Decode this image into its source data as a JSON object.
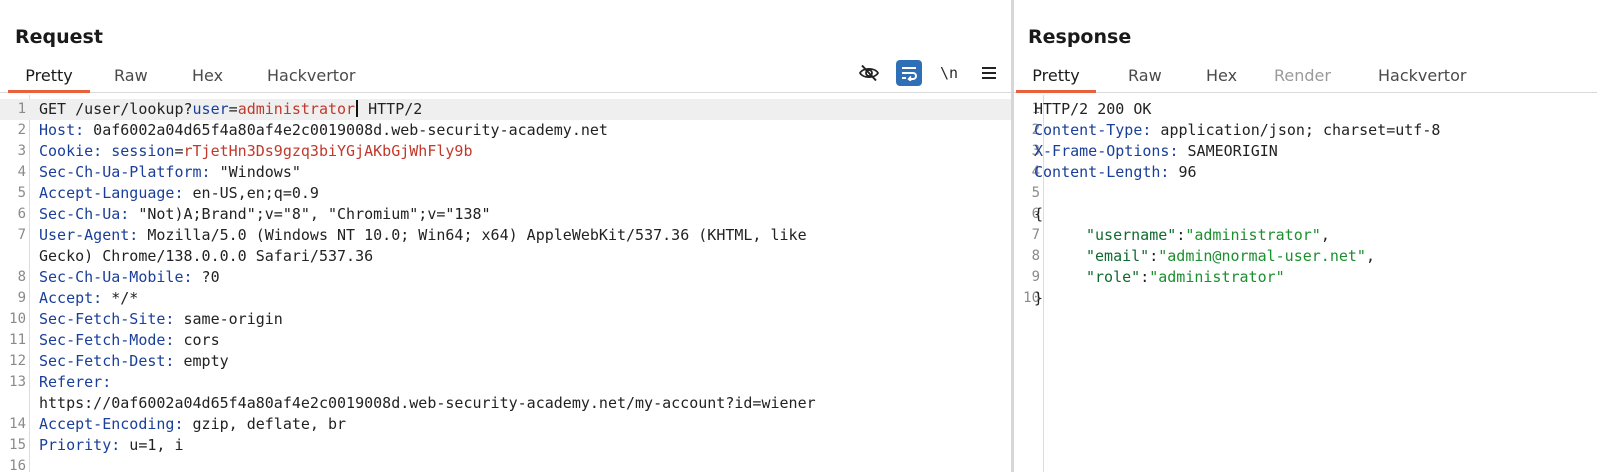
{
  "request": {
    "title": "Request",
    "tabs": [
      "Pretty",
      "Raw",
      "Hex",
      "Hackvertor"
    ],
    "active_tab": "Pretty",
    "toolbar": {
      "icons": [
        "eye-slash-icon",
        "wrap-lines-icon",
        "newline-icon",
        "menu-icon"
      ],
      "newline_label": "\\n"
    },
    "lines": {
      "n1": "1",
      "n2": "2",
      "n3": "3",
      "n4": "4",
      "n5": "5",
      "n6": "6",
      "n7": "7",
      "n8": "8",
      "n9": "9",
      "n10": "10",
      "n11": "11",
      "n12": "12",
      "n13": "13",
      "n14": "14",
      "n15": "15",
      "n16": "16",
      "l1_method": "GET /user/lookup?",
      "l1_param_key": "user",
      "l1_eq": "=",
      "l1_param_val": "administrator",
      "l1_proto": " HTTP/2",
      "l2_name": "Host:",
      "l2_value": " 0af6002a04d65f4a80af4e2c0019008d.web-security-academy.net",
      "l3_name": "Cookie:",
      "l3_ckey": " session",
      "l3_eq": "=",
      "l3_cval": "rTjetHn3Ds9gzq3biYGjAKbGjWhFly9b",
      "l4_name": "Sec-Ch-Ua-Platform:",
      "l4_value": " \"Windows\"",
      "l5_name": "Accept-Language:",
      "l5_value": " en-US,en;q=0.9",
      "l6_name": "Sec-Ch-Ua:",
      "l6_value": " \"Not)A;Brand\";v=\"8\", \"Chromium\";v=\"138\"",
      "l7_name": "User-Agent:",
      "l7_value": " Mozilla/5.0 (Windows NT 10.0; Win64; x64) AppleWebKit/537.36 (KHTML, like",
      "l7_value2": "Gecko) Chrome/138.0.0.0 Safari/537.36",
      "l8_name": "Sec-Ch-Ua-Mobile:",
      "l8_value": " ?0",
      "l9_name": "Accept:",
      "l9_value": " */*",
      "l10_name": "Sec-Fetch-Site:",
      "l10_value": " same-origin",
      "l11_name": "Sec-Fetch-Mode:",
      "l11_value": " cors",
      "l12_name": "Sec-Fetch-Dest:",
      "l12_value": " empty",
      "l13_name": "Referer:",
      "l13_value": "https://0af6002a04d65f4a80af4e2c0019008d.web-security-academy.net/my-account?id=wiener",
      "l14_name": "Accept-Encoding:",
      "l14_value": " gzip, deflate, br",
      "l15_name": "Priority:",
      "l15_value": " u=1, i"
    }
  },
  "response": {
    "title": "Response",
    "tabs": [
      "Pretty",
      "Raw",
      "Hex",
      "Render",
      "Hackvertor"
    ],
    "active_tab": "Pretty",
    "lines": {
      "n1": "1",
      "n2": "2",
      "n3": "3",
      "n4": "4",
      "n5": "5",
      "n6": "6",
      "n7": "7",
      "n8": "8",
      "n9": "9",
      "n10": "10",
      "l1_status": "HTTP/2 200 OK",
      "l2_name": "Content-Type:",
      "l2_value": " application/json; charset=utf-8",
      "l3_name": "X-Frame-Options:",
      "l3_value": " SAMEORIGIN",
      "l4_name": "Content-Length:",
      "l4_value": " 96",
      "l6_brace": "{",
      "l7_key": "\"username\"",
      "l7_sep": ":",
      "l7_val": "\"administrator\"",
      "l7_end": ",",
      "l8_key": "\"email\"",
      "l8_sep": ":",
      "l8_val": "\"admin@normal-user.net\"",
      "l8_end": ",",
      "l9_key": "\"role\"",
      "l9_sep": ":",
      "l9_val": "\"administrator\"",
      "l10_brace": "}"
    }
  },
  "colors": {
    "active_tab_underline": "#e8613a",
    "header_name": "#1a3f9a",
    "param_value": "#c0392b",
    "json_value": "#1c8f2f",
    "active_tool_bg": "#2f6fb5"
  }
}
